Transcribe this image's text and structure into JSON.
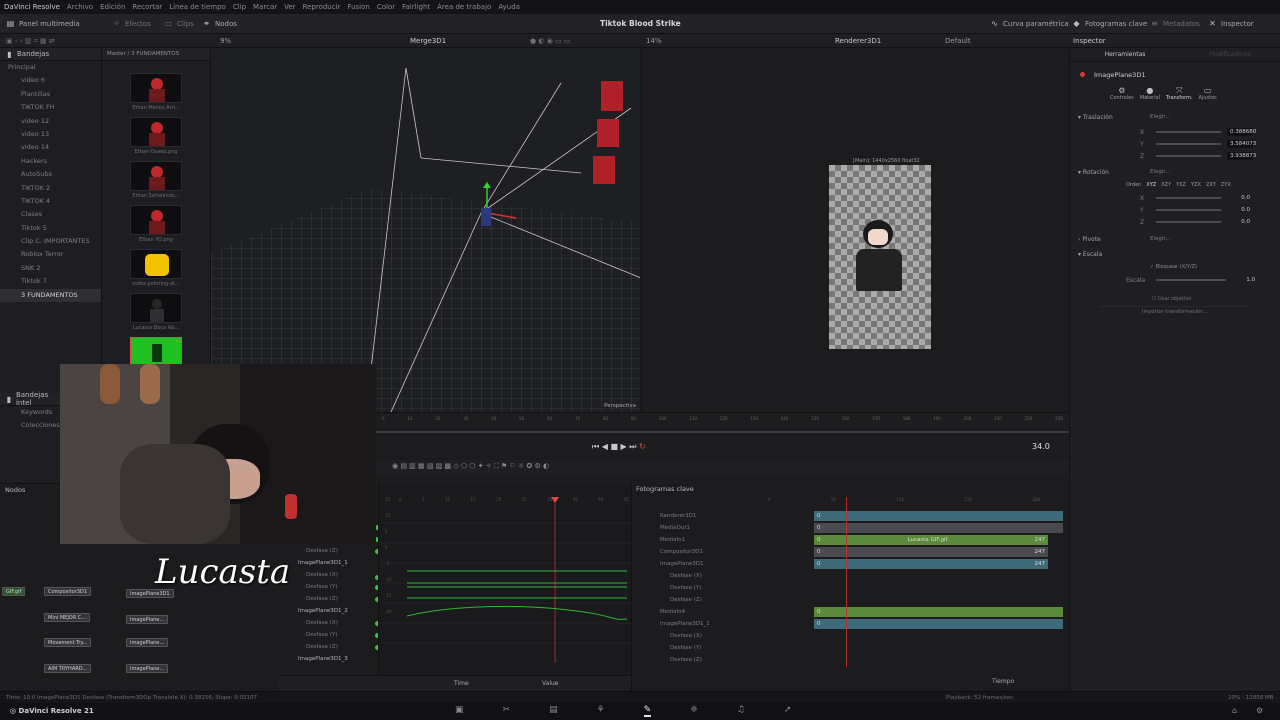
{
  "menu": {
    "app": "DaVinci Resolve",
    "items": [
      "Archivo",
      "Edición",
      "Recortar",
      "Línea de tiempo",
      "Clip",
      "Marcar",
      "Ver",
      "Reproducir",
      "Fusion",
      "Color",
      "Fairlight",
      "Área de trabajo",
      "Ayuda"
    ]
  },
  "toolbar": {
    "media_panel": "Panel multimedia",
    "effects": "Efectos",
    "clips": "Clips",
    "nodes": "Nodos",
    "project_title": "Tiktok Blood Strike",
    "curve": "Curva paramétrica",
    "keyframes": "Fotogramas clave",
    "metadata": "Metadatos",
    "inspector": "Inspector"
  },
  "viewer_bar": {
    "zoom_left": "9%",
    "left_title": "Merge3D1",
    "zoom_right": "14%",
    "right_title": "Renderer3D1",
    "default": "Default",
    "inspector_label": "Inspector"
  },
  "bins": {
    "header": "Bandejas",
    "path": "Master / 3 FUNDAMENTOS",
    "items": [
      "Principal",
      "video 6",
      "Plantillas",
      "TIKTOK FH",
      "video 12",
      "video 13",
      "video 14",
      "Hackers",
      "AutoSubs",
      "TIKTOK 2",
      "TIKTOK 4",
      "Clases",
      "Tiktok 5",
      "Clip C. IMPORTANTES",
      "Roblox Terror",
      "SNK 2",
      "Tiktok 7",
      "3 FUNDAMENTOS"
    ],
    "smart_header": "Bandejas intel",
    "smart_items": [
      "Keywords",
      "Colecciones"
    ]
  },
  "media": [
    {
      "caption": "Ethan Menos Arri..."
    },
    {
      "caption": "Ethan Queso.png"
    },
    {
      "caption": "Ethan Señalando..."
    },
    {
      "caption": "Ethan YO.png"
    },
    {
      "caption": "index-pointing-at..."
    },
    {
      "caption": "Lucasss Boca Ab..."
    }
  ],
  "viewer": {
    "perspective": "Perspectiva",
    "render_info": "[Main]: 1440x2560 float32"
  },
  "transport": {
    "timecode": "34.0",
    "ruler": [
      "0",
      "5",
      "10",
      "15",
      "20",
      "25",
      "30",
      "35",
      "40",
      "45",
      "50",
      "55",
      "60",
      "65",
      "70",
      "75",
      "80",
      "85",
      "90",
      "95",
      "100",
      "105",
      "110",
      "115",
      "120",
      "125",
      "130",
      "135",
      "140",
      "145",
      "150",
      "155",
      "160",
      "165",
      "170",
      "175",
      "180",
      "185",
      "190",
      "195",
      "200",
      "205",
      "210",
      "215",
      "220",
      "225",
      "230",
      "235"
    ]
  },
  "inspector": {
    "tabs": [
      "Herramientas",
      "Modificadores"
    ],
    "node_name": "ImagePlane3D1",
    "subtabs": [
      "Controles",
      "Material",
      "Transform.",
      "Ajustes"
    ],
    "translation": {
      "label": "Traslación",
      "pick": "Elegir...",
      "x_label": "X",
      "x": "0.388680",
      "y_label": "Y",
      "y": "3.584073",
      "z_label": "Z",
      "z": "3.938873"
    },
    "rotation": {
      "label": "Rotación",
      "pick": "Elegir...",
      "order_label": "Orden",
      "orders": [
        "XYZ",
        "XZY",
        "YXZ",
        "YZX",
        "ZXY",
        "ZYX"
      ],
      "x_label": "X",
      "x": "0.0",
      "y_label": "Y",
      "y": "0.0",
      "z_label": "Z",
      "z": "0.0"
    },
    "pivot": {
      "label": "Pivote",
      "pick": "Elegir..."
    },
    "scale": {
      "label": "Escala",
      "lock": "Bloquear (X/Y/Z)",
      "scale_label": "Escala",
      "value": "1.0"
    },
    "use_target": "Usar objetivo",
    "import": "Importar transformación..."
  },
  "nodes": {
    "header": "Nodos",
    "items": [
      "GIF.gif",
      "Compositor3D1",
      "ImagePlane3D1",
      "Mini MEJOR C...",
      "ImagePlane...",
      "Movement Try...",
      "ImagePlane...",
      "AIM TRYHARD...",
      "ImagePlane..."
    ]
  },
  "spline": {
    "left_items": [
      "Desfase (Z)",
      "ImagePlane3D1_1",
      "Desfase (X)",
      "Desfase (Y)",
      "Desfase (Z)",
      "ImagePlane3D1_2",
      "Desfase (X)",
      "Desfase (Y)",
      "Desfase (Z)",
      "ImagePlane3D1_3",
      "Desfase (X)"
    ],
    "y_labels": [
      "15",
      "10",
      "5",
      "0",
      "-5",
      "-10",
      "-15",
      "-20"
    ],
    "x_labels": [
      "0",
      "5",
      "10",
      "15",
      "20",
      "25",
      "30",
      "35",
      "40",
      "45"
    ],
    "time_label": "Time",
    "value_label": "Value"
  },
  "keyframes": {
    "header": "Fotogramas clave",
    "rows": [
      "Renderer3D1",
      "MediaOut1",
      "MediaIn1",
      "Compositor3D1",
      "ImagePlane3D1",
      "Desfase (X)",
      "Desfase (Y)",
      "Desfase (Z)",
      "MediaIn4",
      "ImagePlane3D1_1",
      "Desfase (X)",
      "Desfase (Y)",
      "Desfase (Z)"
    ],
    "ruler": [
      "0",
      "50",
      "100",
      "150",
      "200"
    ],
    "bar_start": "0",
    "bar_end": "247",
    "gif_label": "Lucasta GIF.gif",
    "tiempo": "Tiempo"
  },
  "webcam": {
    "overlay": "Lucasta"
  },
  "status": {
    "left": "Time: 10.0     ImagePlane3D1 Desfase (Transform3DOp.Translate.X): 0.38156,  Slope: 0.02107",
    "playback": "Playback: 52 frames/sec",
    "memory": "20% - 12858 MB"
  },
  "footer": {
    "app": "DaVinci Resolve 21"
  }
}
